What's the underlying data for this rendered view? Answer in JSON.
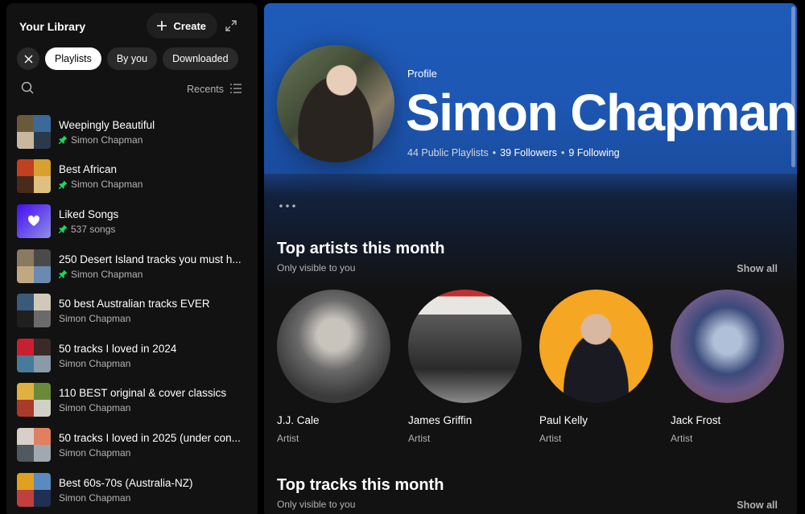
{
  "library": {
    "title": "Your Library",
    "create_label": "Create",
    "filters": [
      "Playlists",
      "By you",
      "Downloaded"
    ],
    "sort_label": "Recents",
    "items": [
      {
        "title": "Weepingly Beautiful",
        "subtitle": "Simon Chapman",
        "pinned": true,
        "colors": [
          "#6b5a3a",
          "#3a6a9a",
          "#c8b8a0",
          "#2a3a4a"
        ]
      },
      {
        "title": "Best African",
        "subtitle": "Simon Chapman",
        "pinned": true,
        "colors": [
          "#c04020",
          "#d8a030",
          "#4a2a1a",
          "#e0c080"
        ]
      },
      {
        "title": "Liked Songs",
        "subtitle": "537 songs",
        "pinned": true,
        "liked": true
      },
      {
        "title": "250 Desert Island tracks you must h...",
        "subtitle": "Simon Chapman",
        "pinned": true,
        "colors": [
          "#8a7a60",
          "#4a4a4a",
          "#c0a880",
          "#6a8ab0"
        ]
      },
      {
        "title": "50 best Australian tracks EVER",
        "subtitle": "Simon Chapman",
        "pinned": false,
        "colors": [
          "#3a5a7a",
          "#d0c8b8",
          "#202020",
          "#6a6a6a"
        ]
      },
      {
        "title": "50 tracks I loved in 2024",
        "subtitle": "Simon Chapman",
        "pinned": false,
        "colors": [
          "#c82030",
          "#3a2a2a",
          "#4a7a9a",
          "#8a9aa8"
        ]
      },
      {
        "title": "110 BEST original & cover classics",
        "subtitle": "Simon Chapman",
        "pinned": false,
        "colors": [
          "#e0b040",
          "#6a8a3a",
          "#aa3a2a",
          "#d0d0c8"
        ]
      },
      {
        "title": "50 tracks I loved in 2025 (under con...",
        "subtitle": "Simon Chapman",
        "pinned": false,
        "colors": [
          "#d8d0c8",
          "#e08060",
          "#505860",
          "#a0a8b0"
        ]
      },
      {
        "title": "Best 60s-70s (Australia-NZ)",
        "subtitle": "Simon Chapman",
        "pinned": false,
        "colors": [
          "#e0a020",
          "#5a8ac0",
          "#c04040",
          "#203050"
        ]
      }
    ]
  },
  "profile": {
    "label": "Profile",
    "name": "Simon Chapman",
    "playlists": "44 Public Playlists",
    "followers": "39 Followers",
    "following": "9 Following",
    "separator": "•"
  },
  "top_artists": {
    "title": "Top artists this month",
    "subtitle": "Only visible to you",
    "show_all": "Show all",
    "artists": [
      {
        "name": "J.J. Cale",
        "type": "Artist",
        "bg": "radial-gradient(circle at 50% 40%, #c8c4bc 0 18%, #6a6a6a 40%, #3a3a3a 70%)"
      },
      {
        "name": "James Griffin",
        "type": "Artist",
        "bg": "linear-gradient(180deg, #c03030 0 6%, #e8e6e2 6% 22%, #5a5a5a 22%, #2a2a2a 70%, #8a8a8a)"
      },
      {
        "name": "Paul Kelly",
        "type": "Artist",
        "bg": "radial-gradient(circle at 50% 35%, #d8b8a0 0 16%, transparent 17%), radial-gradient(ellipse at 50% 90%, #1a1a22 0 40%, transparent 41%), #f5a623"
      },
      {
        "name": "Jack Frost",
        "type": "Artist",
        "bg": "radial-gradient(circle at 50% 45%, #b0c0d8 0 16%, #3a4a7a 40%, #6a5a8a 60%, #8a4a3a)"
      }
    ]
  },
  "top_tracks": {
    "title": "Top tracks this month",
    "subtitle": "Only visible to you",
    "show_all": "Show all"
  }
}
